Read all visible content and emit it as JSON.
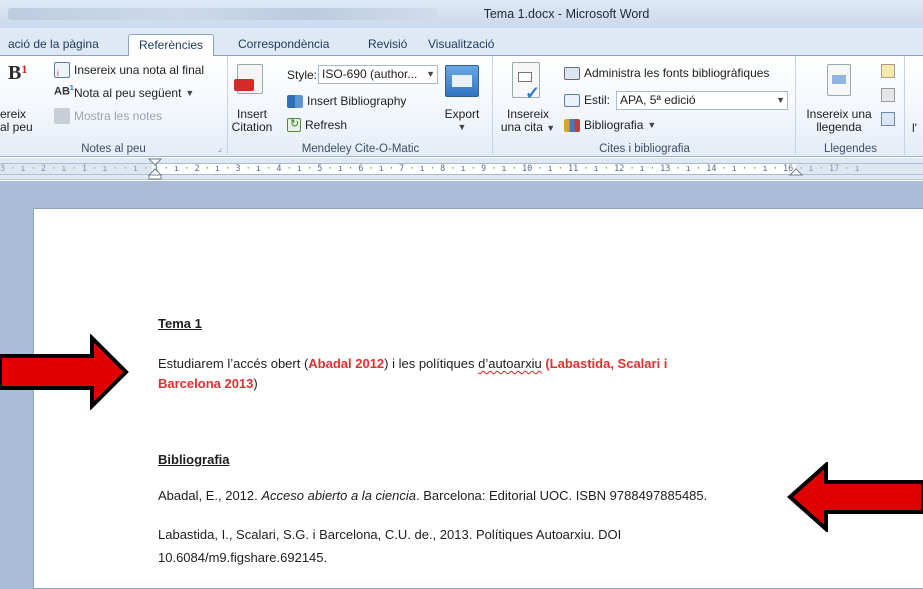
{
  "titlebar": {
    "title": "Tema 1.docx - Microsoft Word"
  },
  "tabs": [
    {
      "label": "ació de la pàgina"
    },
    {
      "label": "Referències"
    },
    {
      "label": "Correspondència"
    },
    {
      "label": "Revisió"
    },
    {
      "label": "Visualització"
    }
  ],
  "ribbon": {
    "footnotes": {
      "big_partial_1": "ereix",
      "big_partial_2": "al peu",
      "insert_endnote": "Insereix una nota al final",
      "next_footnote": "Nota al peu següent",
      "show_notes": "Mostra les notes",
      "label": "Notes al peu"
    },
    "mendeley": {
      "insert_citation_1": "Insert",
      "insert_citation_2": "Citation",
      "style_label": "Style:",
      "style_value": "ISO-690 (author...",
      "insert_bibliography": "Insert Bibliography",
      "refresh": "Refresh",
      "export": "Export",
      "label": "Mendeley Cite-O-Matic"
    },
    "citations": {
      "insert_citation_1": "Insereix",
      "insert_citation_2": "una cita",
      "manage_sources": "Administra les fonts bibliogràfiques",
      "style_label": "Estil:",
      "style_value": "APA, 5ª edició",
      "bibliography": "Bibliografia",
      "label": "Cites i bibliografia"
    },
    "captions": {
      "insert_caption_1": "Insereix una",
      "insert_caption_2": "llegenda",
      "partial": "l'",
      "label": "Llegendes"
    }
  },
  "ruler": {
    "text": "3 · ı · 2 · ı · 1 · ı ·   · ı · 1 · ı · 2 · ı · 3 · ı · 4 · ı · 5 · ı · 6 · ı · 7 · ı · 8 · ı · 9 · ı · 10 · ı · 11 · ı · 12 · ı · 13 · ı · 14 · ı ·   · ı · 16 · ı · 17 · ı"
  },
  "document": {
    "heading": "Tema 1",
    "para_a": "Estudiarem l’accés obert (",
    "cite1": "Abadal 2012",
    "para_b": ")  i les polítiques ",
    "para_squig": "d’autoarxiu",
    "cite2_line1": " (Labastida, Scalari i",
    "cite2_line2": "Barcelona 2013",
    "para_c": ")",
    "biblio_heading": "Bibliografia",
    "ref1_a": "Abadal, E., 2012.  ",
    "ref1_title": "Acceso abierto a la ciencia",
    "ref1_b": ". Barcelona: Editorial UOC. ISBN 9788497885485.",
    "ref2_line1": "Labastida, I., Scalari, S.G. i Barcelona, C.U. de., 2013. Polítiques Autoarxiu. DOI",
    "ref2_line2": "10.6084/m9.figshare.692145."
  },
  "colors": {
    "arrow_fill": "#e00000",
    "citation_red": "#e03030"
  }
}
